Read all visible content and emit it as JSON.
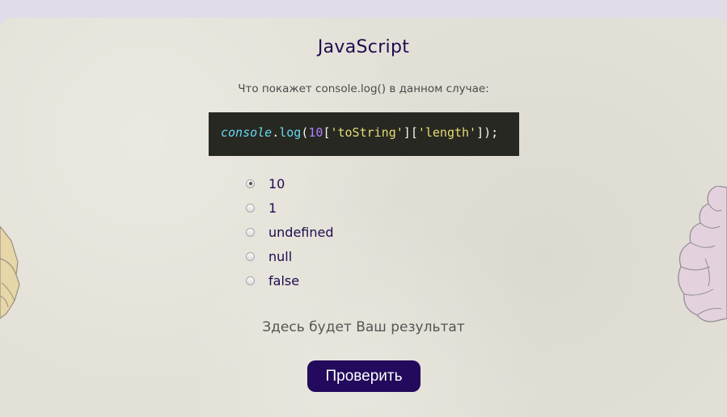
{
  "quiz": {
    "title": "JavaScript",
    "question": "Что покажет console.log() в данном случае:",
    "code": {
      "object": "console",
      "dot": ".",
      "method": "log",
      "open_paren": "(",
      "number": "10",
      "bracket_open_1": "[",
      "string_1": "'toString'",
      "bracket_close_1": "]",
      "bracket_open_2": "[",
      "string_2": "'length'",
      "bracket_close_2": "]",
      "close": ");"
    },
    "options": [
      {
        "label": "10",
        "selected": true
      },
      {
        "label": "1",
        "selected": false
      },
      {
        "label": "undefined",
        "selected": false
      },
      {
        "label": "null",
        "selected": false
      },
      {
        "label": "false",
        "selected": false
      }
    ],
    "result_placeholder": "Здесь будет Ваш результат",
    "submit_label": "Проверить"
  },
  "colors": {
    "accent": "#230a5c",
    "title": "#1e0b4e",
    "card_bg": "#e3e1d7",
    "code_bg": "#272822"
  },
  "icons": {
    "left_decoration": "hand-illustration-icon",
    "right_decoration": "brain-illustration-icon"
  }
}
